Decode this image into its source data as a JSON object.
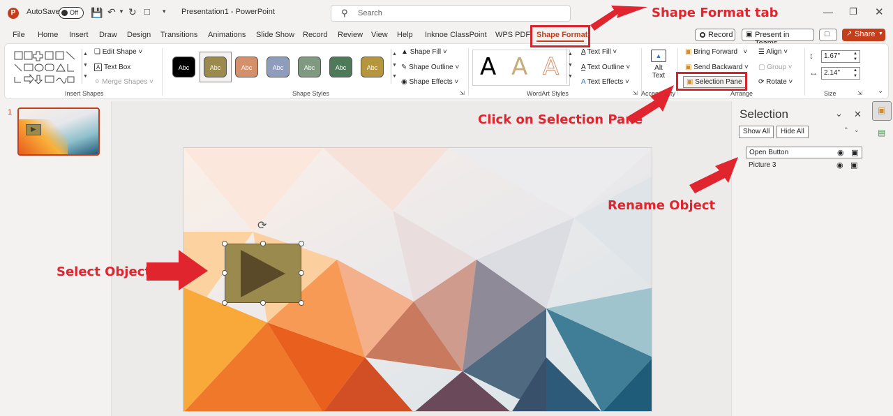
{
  "titlebar": {
    "autosave_label": "AutoSave",
    "autosave_state": "Off",
    "doc_title": "Presentation1  -  PowerPoint",
    "search_placeholder": "Search"
  },
  "tabs": [
    "File",
    "Home",
    "Insert",
    "Draw",
    "Design",
    "Transitions",
    "Animations",
    "Slide Show",
    "Record",
    "Review",
    "View",
    "Help",
    "Inknoe ClassPoint",
    "WPS PDF",
    "Shape Format"
  ],
  "tab_actions": {
    "record": "Record",
    "present_teams": "Present in Teams",
    "share": "Share"
  },
  "ribbon": {
    "insert_shapes": {
      "edit_shape": "Edit Shape",
      "text_box": "Text Box",
      "merge_shapes": "Merge Shapes",
      "label": "Insert Shapes"
    },
    "shape_styles": {
      "swatch_text": "Abc",
      "shape_fill": "Shape Fill",
      "shape_outline": "Shape Outline",
      "shape_effects": "Shape Effects",
      "label": "Shape Styles"
    },
    "wordart": {
      "letter": "A",
      "text_fill": "Text Fill",
      "text_outline": "Text Outline",
      "text_effects": "Text Effects",
      "label": "WordArt Styles"
    },
    "accessibility": {
      "alt_text_1": "Alt",
      "alt_text_2": "Text",
      "label": "Accessibility"
    },
    "arrange": {
      "bring_forward": "Bring Forward",
      "send_backward": "Send Backward",
      "selection_pane": "Selection Pane",
      "align": "Align",
      "group": "Group",
      "rotate": "Rotate",
      "label": "Arrange"
    },
    "size": {
      "height": "1.67\"",
      "width": "2.14\"",
      "label": "Size"
    }
  },
  "colors": {
    "accent": "#c43e1c",
    "annotation": "#e0252f",
    "swatches": [
      "#000000",
      "#9a8a4e",
      "#d4906a",
      "#8f9dbd",
      "#7f9a80",
      "#4f7a5a",
      "#b5963e"
    ]
  },
  "thumbnail": {
    "number": "1"
  },
  "selection_pane": {
    "title": "Selection",
    "show_all": "Show All",
    "hide_all": "Hide All",
    "items": [
      "Open Button",
      "Picture 3"
    ]
  },
  "annotations": {
    "shape_format_tab": "Shape Format tab",
    "click_selection_pane": "Click on Selection Pane",
    "rename_object": "Rename Object",
    "select_object": "Select Object"
  }
}
